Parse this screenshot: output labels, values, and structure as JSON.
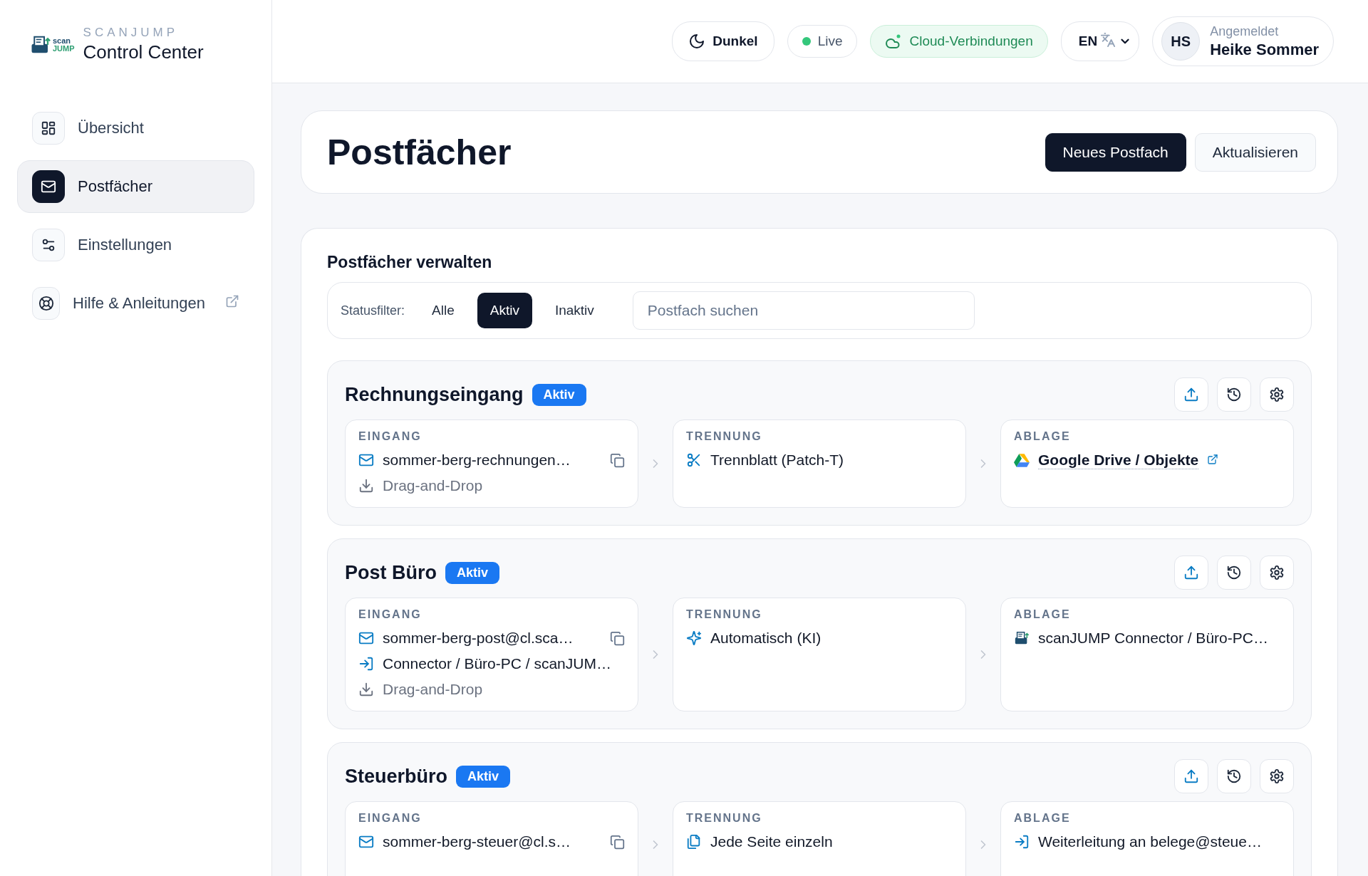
{
  "sidebar": {
    "logo": {
      "mark_lines": [
        "scan",
        "JUMP"
      ],
      "brand": "SCANJUMP",
      "title": "Control Center"
    },
    "items": [
      {
        "label": "Übersicht",
        "selected": false,
        "external": false
      },
      {
        "label": "Postfächer",
        "selected": true,
        "external": false
      },
      {
        "label": "Einstellungen",
        "selected": false,
        "external": false
      },
      {
        "label": "Hilfe & Anleitungen",
        "selected": false,
        "external": true
      }
    ]
  },
  "topbar": {
    "theme_toggle": "Dunkel",
    "status": {
      "label": "Live",
      "color": "#34c77b"
    },
    "cloud": "Cloud-Verbindungen",
    "language": "EN",
    "user": {
      "initials": "HS",
      "caption": "Angemeldet",
      "name": "Heike Sommer"
    }
  },
  "header": {
    "title": "Postfächer",
    "buttons": [
      {
        "label": "Neues Postfach",
        "kind": "primary"
      },
      {
        "label": "Aktualisieren",
        "kind": "secondary"
      }
    ]
  },
  "manage": {
    "title": "Postfächer verwalten",
    "filter_label": "Statusfilter:",
    "filters": [
      {
        "label": "Alle",
        "selected": false
      },
      {
        "label": "Aktiv",
        "selected": true
      },
      {
        "label": "Inaktiv",
        "selected": false
      }
    ],
    "search": {
      "placeholder": "Postfach suchen"
    }
  },
  "mailboxes": [
    {
      "name": "Rechnungseingang",
      "status": "Aktiv",
      "steps": [
        {
          "label": "EINGANG",
          "lines": [
            {
              "kind": "email",
              "text": "sommer-berg-rechnungen…",
              "copyable": true
            },
            {
              "kind": "dragdrop",
              "text": "Drag-and-Drop"
            }
          ]
        },
        {
          "label": "TRENNUNG",
          "lines": [
            {
              "kind": "patch",
              "text": "Trennblatt (Patch-T)"
            }
          ]
        },
        {
          "label": "ABLAGE",
          "lines": [
            {
              "kind": "drive",
              "text": "Google Drive / Objekte"
            }
          ]
        }
      ]
    },
    {
      "name": "Post Büro",
      "status": "Aktiv",
      "steps": [
        {
          "label": "EINGANG",
          "lines": [
            {
              "kind": "email",
              "text": "sommer-berg-post@cl.sca…",
              "copyable": true
            },
            {
              "kind": "connector",
              "text": "Connector / Büro-PC / scanJUM…"
            },
            {
              "kind": "dragdrop",
              "text": "Drag-and-Drop"
            }
          ]
        },
        {
          "label": "TRENNUNG",
          "lines": [
            {
              "kind": "ai",
              "text": "Automatisch (KI)"
            }
          ]
        },
        {
          "label": "ABLAGE",
          "lines": [
            {
              "kind": "scanner",
              "text": "scanJUMP Connector / Büro-PC…"
            }
          ]
        }
      ]
    },
    {
      "name": "Steuerbüro",
      "status": "Aktiv",
      "steps": [
        {
          "label": "EINGANG",
          "lines": [
            {
              "kind": "email",
              "text": "sommer-berg-steuer@cl.s…",
              "copyable": true
            }
          ]
        },
        {
          "label": "TRENNUNG",
          "lines": [
            {
              "kind": "pages",
              "text": "Jede Seite einzeln"
            }
          ]
        },
        {
          "label": "ABLAGE",
          "lines": [
            {
              "kind": "forward",
              "text": "Weiterleitung an belege@steue…"
            }
          ]
        }
      ]
    }
  ]
}
